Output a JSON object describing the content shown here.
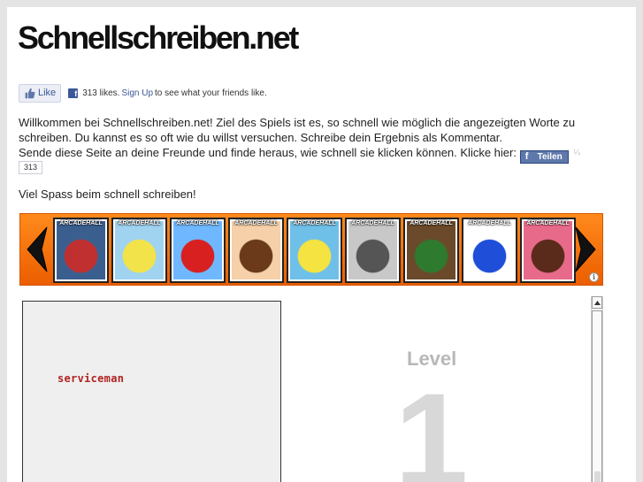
{
  "header": {
    "title": "Schnellschreiben.net"
  },
  "facebook": {
    "like_label": "Like",
    "fb_icon": "f",
    "like_count_text": "313 likes.",
    "signup_label": "Sign Up",
    "signup_suffix": "to see what your friends like.",
    "share_label": "Teilen",
    "share_count": "313"
  },
  "intro": {
    "line1": "Willkommen bei Schnellschreiben.net! Ziel des Spiels ist es, so schnell wie möglich die angezeigten Worte zu schreiben. Du kannst es so oft wie du willst versuchen. Schreibe dein Ergebnis als Kommentar.",
    "line2": "Sende diese Seite an deine Freunde und finde heraus, wie schnell sie klicken können. Klicke hier:",
    "share_tail": "¼",
    "closing": "Viel Spass beim schnell schreiben!"
  },
  "carousel": {
    "brand": "ARCADEHALL",
    "info_glyph": "i",
    "colors": {
      "bg": "#f36b00",
      "arrow": "#111111"
    },
    "thumbnails": [
      {
        "name": "racing-car",
        "bg": "#3a5f8f",
        "fg": "#c03030"
      },
      {
        "name": "spongebob-surf",
        "bg": "#9fd3f0",
        "fg": "#f2e34a"
      },
      {
        "name": "mario",
        "bg": "#6fb8ff",
        "fg": "#d82020"
      },
      {
        "name": "dora",
        "bg": "#f5d0a8",
        "fg": "#6b3a1a"
      },
      {
        "name": "spongebob",
        "bg": "#6fc0e8",
        "fg": "#f5e342"
      },
      {
        "name": "skater",
        "bg": "#c8c8c8",
        "fg": "#555555"
      },
      {
        "name": "ben10",
        "bg": "#6a4a2a",
        "fg": "#2e7a2e"
      },
      {
        "name": "sonic",
        "bg": "#ffffff",
        "fg": "#1f4ed8"
      },
      {
        "name": "girl-avatar",
        "bg": "#e86a8a",
        "fg": "#5a2a1a"
      }
    ]
  },
  "game": {
    "current_word": "serviceman",
    "level_label": "Level",
    "level_number": "1"
  }
}
